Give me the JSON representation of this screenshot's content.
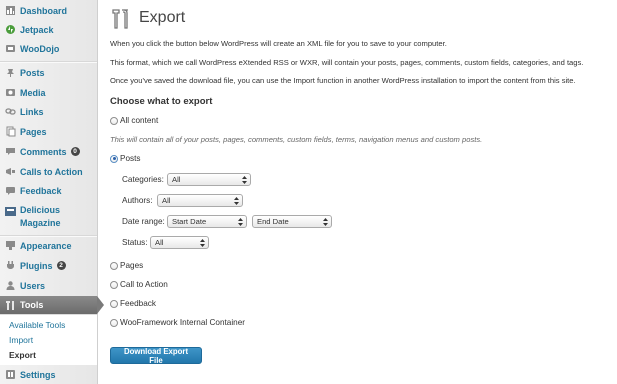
{
  "sidebar": {
    "items": [
      {
        "label": "Dashboard",
        "icon": "dashboard-icon"
      },
      {
        "label": "Jetpack",
        "icon": "jetpack-icon"
      },
      {
        "label": "WooDojo",
        "icon": "woodojo-icon"
      },
      {
        "label": "Posts",
        "icon": "pin-icon"
      },
      {
        "label": "Media",
        "icon": "media-icon"
      },
      {
        "label": "Links",
        "icon": "link-icon"
      },
      {
        "label": "Pages",
        "icon": "pages-icon"
      },
      {
        "label": "Comments",
        "icon": "comments-icon",
        "badge": "0"
      },
      {
        "label": "Calls to Action",
        "icon": "calls-to-action-icon"
      },
      {
        "label": "Feedback",
        "icon": "feedback-icon"
      },
      {
        "label": "Delicious",
        "label2": "Magazine",
        "icon": "delicious-magazine-icon"
      },
      {
        "label": "Appearance",
        "icon": "appearance-icon"
      },
      {
        "label": "Plugins",
        "icon": "plugins-icon",
        "badge": "2"
      },
      {
        "label": "Users",
        "icon": "users-icon"
      },
      {
        "label": "Tools",
        "icon": "tools-icon",
        "current": true
      },
      {
        "label": "Settings",
        "icon": "settings-icon"
      }
    ],
    "tools_submenu": [
      "Available Tools",
      "Import",
      "Export"
    ],
    "current_submenu": "Export"
  },
  "page": {
    "title": "Export",
    "intro": [
      "When you click the button below WordPress will create an XML file for you to save to your computer.",
      "This format, which we call WordPress eXtended RSS or WXR, will contain your posts, pages, comments, custom fields, categories, and tags.",
      "Once you've saved the download file, you can use the Import function in another WordPress installation to import the content from this site."
    ],
    "heading": "Choose what to export"
  },
  "options": {
    "all_content": "All content",
    "all_content_desc": "This will contain all of your posts, pages, comments, custom fields, terms, navigation menus and custom posts.",
    "posts": "Posts",
    "pages": "Pages",
    "call_to_action": "Call to Action",
    "feedback": "Feedback",
    "woo_container": "WooFramework Internal Container",
    "selected": "posts"
  },
  "post_filters": {
    "categories_label": "Categories:",
    "categories_value": "All",
    "authors_label": "Authors:",
    "authors_value": "All",
    "date_range_label": "Date range:",
    "start_date": "Start Date",
    "end_date": "End Date",
    "status_label": "Status:",
    "status_value": "All"
  },
  "download_button": "Download Export File",
  "colors": {
    "link": "#21759b",
    "button": "#2a7db3",
    "active_menu": "#7a7a7a"
  }
}
